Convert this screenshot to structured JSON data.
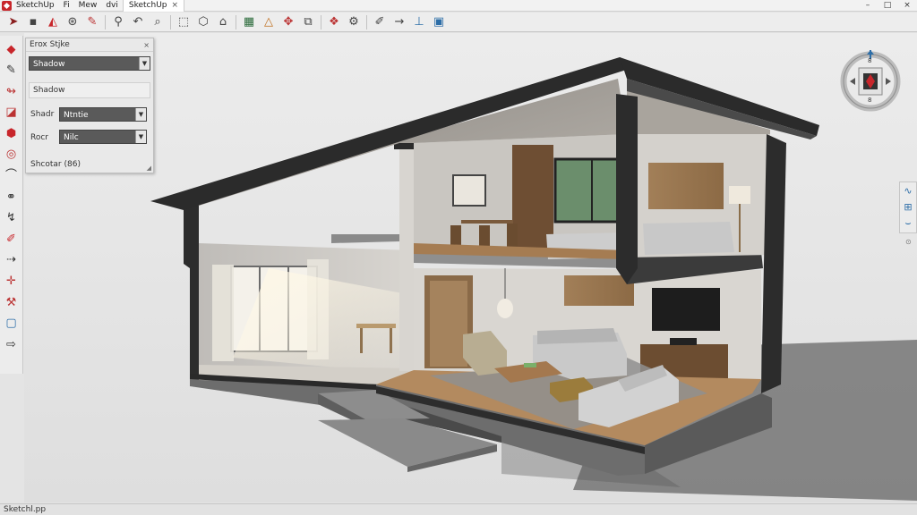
{
  "titlebar": {
    "app_name": "SketchUp",
    "menu": [
      "Fi",
      "Mew",
      "dvi"
    ],
    "tab_label": "SketchUp",
    "tab_close": "×",
    "minimize": "–",
    "maximize": "□",
    "close": "×"
  },
  "toolbar": {
    "icons": [
      "select-arrow-icon",
      "save-icon",
      "paint-icon",
      "orbit-icon",
      "pencil-icon",
      "zoom-icon",
      "undo-icon",
      "zoom-window-icon",
      "box-icon",
      "cube-icon",
      "door-icon",
      "grid-icon",
      "triangle-icon",
      "move-icon",
      "component-icon",
      "layers-icon",
      "settings-icon",
      "pipette-icon",
      "arrow-right-icon",
      "axes-icon",
      "window-icon"
    ]
  },
  "left_tools": {
    "icons": [
      "eraser-icon",
      "pencil-icon",
      "follow-me-icon",
      "section-icon",
      "paint-bucket-icon",
      "tape-icon",
      "arc-icon",
      "glasses-icon",
      "push-pull-icon",
      "pen-icon",
      "dimension-icon",
      "axis-icon",
      "hammer-icon",
      "rectangle-icon",
      "walk-icon"
    ]
  },
  "styles_panel": {
    "title": "Erox Stjke",
    "close": "×",
    "style_select": "Shadow",
    "shadow_label": "Shadow",
    "shader_label": "Shadr",
    "shader_value": "Ntntie",
    "render_label": "Rocr",
    "render_value": "Nilc",
    "footer_label": "Shcotar (86)",
    "grip": "◢"
  },
  "navcube": {
    "top_label": "8",
    "bottom_label": "8"
  },
  "right_tools": {
    "icons": [
      "wave-icon",
      "grid-icon",
      "swoosh-icon"
    ],
    "dot": "⊙"
  },
  "statusbar": {
    "text": "Sketchl.pp"
  },
  "colors": {
    "accent": "#c8262b",
    "link_blue": "#2d6ea8"
  }
}
